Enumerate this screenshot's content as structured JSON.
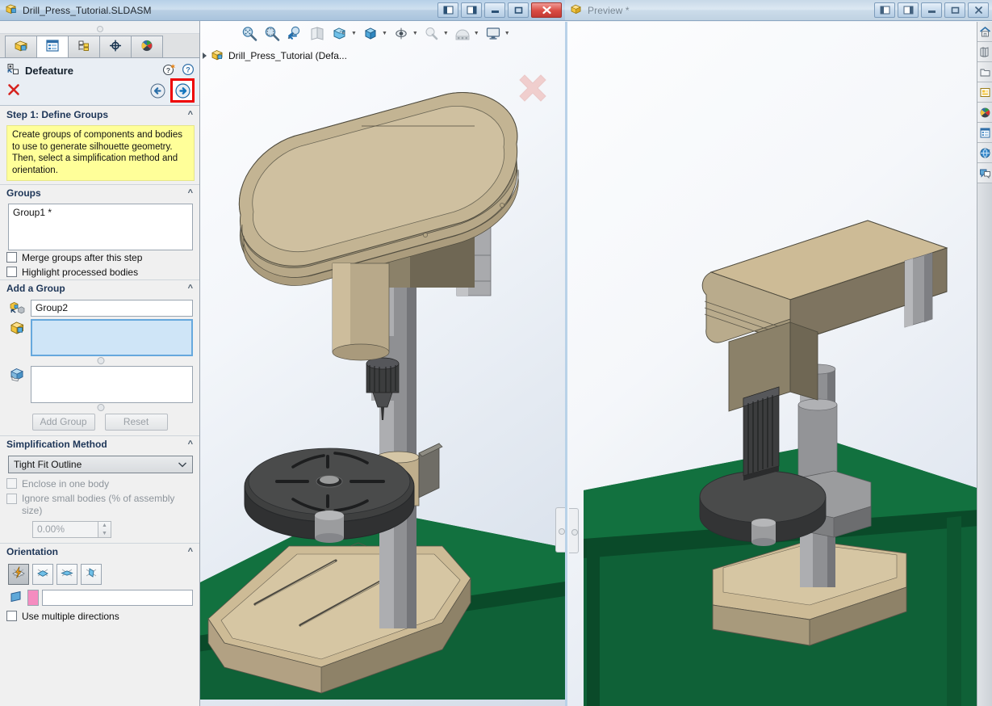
{
  "window": {
    "title": "Drill_Press_Tutorial.SLDASM",
    "icon": "solidworks-assembly-icon",
    "buttons": [
      {
        "name": "split-left-button",
        "label": "◧"
      },
      {
        "name": "split-right-button",
        "label": "◨"
      },
      {
        "name": "minimize-button",
        "label": "—"
      },
      {
        "name": "restore-button",
        "label": "□"
      },
      {
        "name": "close-button",
        "label": "✕"
      }
    ]
  },
  "property_manager": {
    "tabs": [
      {
        "name": "feature-manager-tab",
        "icon": "feature-tree-icon",
        "active": false
      },
      {
        "name": "property-manager-tab",
        "icon": "property-list-icon",
        "active": true
      },
      {
        "name": "configuration-manager-tab",
        "icon": "configuration-icon",
        "active": false
      },
      {
        "name": "dimxpert-manager-tab",
        "icon": "dimxpert-target-icon",
        "active": false
      },
      {
        "name": "display-manager-tab",
        "icon": "display-sphere-icon",
        "active": false
      }
    ],
    "title": "Defeature",
    "header_icons": [
      {
        "name": "help-whats-new-icon",
        "glyph": "?"
      },
      {
        "name": "help-icon",
        "glyph": "?"
      }
    ],
    "cancel_label": "✕",
    "nav": {
      "back_label": "←",
      "next_label": "→",
      "next_highlighted": true,
      "highlight_color": "#ee0000"
    },
    "step": {
      "heading": "Step 1: Define Groups",
      "tip": "Create groups of components and bodies to use to generate silhouette geometry. Then, select a simplification method and orientation.",
      "tip_bg": "#ffff99"
    },
    "groups": {
      "heading": "Groups",
      "items": [
        "Group1 *"
      ],
      "checkboxes": [
        {
          "name": "merge-groups-checkbox",
          "label": "Merge groups after this step",
          "checked": false,
          "disabled": false
        },
        {
          "name": "highlight-bodies-checkbox",
          "label": "Highlight processed bodies",
          "checked": false,
          "disabled": false
        }
      ]
    },
    "add_group": {
      "heading": "Add a Group",
      "name_icon": "group-name-icon",
      "name_value": "Group2",
      "components_icon": "component-box-icon",
      "components_value": "",
      "components_selected": true,
      "bodies_icon": "body-face-icon",
      "bodies_value": "",
      "add_button": "Add Group",
      "reset_button": "Reset"
    },
    "simplification": {
      "heading": "Simplification Method",
      "selected": "Tight Fit Outline",
      "options": [
        "Tight Fit Outline"
      ],
      "checkboxes": [
        {
          "name": "enclose-one-body-checkbox",
          "label": "Enclose in one body",
          "checked": false,
          "disabled": true
        },
        {
          "name": "ignore-small-bodies-checkbox",
          "label": "Ignore small bodies (% of assembly size)",
          "checked": false,
          "disabled": true
        }
      ],
      "percent_value": "0.00%"
    },
    "orientation": {
      "heading": "Orientation",
      "buttons": [
        {
          "name": "orientation-auto-button",
          "icon": "auto-orientation-icon",
          "selected": true
        },
        {
          "name": "orientation-single-button",
          "icon": "single-direction-icon",
          "selected": false
        },
        {
          "name": "orientation-dual-button",
          "icon": "dual-direction-icon",
          "selected": false
        },
        {
          "name": "orientation-custom-button",
          "icon": "custom-direction-icon",
          "selected": false
        }
      ],
      "plane_icon": "plane-icon",
      "direction_value": "",
      "swatch_color": "#f58cc0",
      "use_multiple_label": "Use multiple directions",
      "use_multiple_checked": false
    }
  },
  "viewport": {
    "toolbar": [
      {
        "name": "zoom-to-fit-button",
        "icon": "zoom-fit-icon",
        "caret": false
      },
      {
        "name": "zoom-to-area-button",
        "icon": "zoom-area-icon",
        "caret": false
      },
      {
        "name": "previous-view-button",
        "icon": "previous-view-icon",
        "caret": false
      },
      {
        "name": "section-view-button",
        "icon": "section-view-icon",
        "caret": false
      },
      {
        "name": "view-orientation-button",
        "icon": "view-orientation-icon",
        "caret": true
      },
      {
        "name": "display-style-button",
        "icon": "display-style-icon",
        "caret": true
      },
      {
        "name": "hide-show-button",
        "icon": "hide-show-icon",
        "caret": true
      },
      {
        "name": "edit-appearance-button",
        "icon": "edit-appearance-icon",
        "caret": true
      },
      {
        "name": "apply-scene-button",
        "icon": "apply-scene-icon",
        "caret": true
      },
      {
        "name": "view-settings-button",
        "icon": "view-settings-icon",
        "caret": true
      }
    ],
    "tree_node": "Drill_Press_Tutorial  (Defa...",
    "tree_node_icon": "assembly-icon",
    "confirm_icon": "confirm-cancel-x-icon",
    "model_colors": {
      "head_top": "#cdbb96",
      "head_side": "#7e7460",
      "column": "#9a9a9c",
      "table": "#4e4f4f",
      "base_plate": "#d0c19f",
      "bench": "#0f6137"
    }
  },
  "preview": {
    "title": "Preview *",
    "icon": "preview-part-icon",
    "buttons": [
      {
        "name": "preview-split-left-button",
        "label": "◧"
      },
      {
        "name": "preview-split-right-button",
        "label": "◨"
      },
      {
        "name": "preview-minimize-button",
        "label": "—"
      },
      {
        "name": "preview-restore-button",
        "label": "□"
      },
      {
        "name": "preview-close-button",
        "label": "✕"
      }
    ]
  },
  "task_pane": [
    {
      "name": "task-pane-home-button",
      "icon": "home-icon"
    },
    {
      "name": "task-pane-design-library-button",
      "icon": "design-library-icon"
    },
    {
      "name": "task-pane-file-explorer-button",
      "icon": "file-explorer-icon"
    },
    {
      "name": "task-pane-view-palette-button",
      "icon": "view-palette-icon"
    },
    {
      "name": "task-pane-appearances-button",
      "icon": "appearances-sphere-icon"
    },
    {
      "name": "task-pane-custom-properties-button",
      "icon": "custom-properties-icon"
    },
    {
      "name": "task-pane-content-central-button",
      "icon": "3d-content-central-icon"
    },
    {
      "name": "task-pane-forum-button",
      "icon": "solidworks-forum-icon"
    }
  ]
}
